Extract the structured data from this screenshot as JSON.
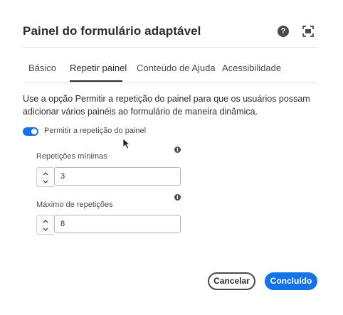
{
  "dialog": {
    "title": "Painel do formulário adaptável",
    "help_icon": "help-icon",
    "fullscreen_icon": "fullscreen-icon"
  },
  "tabs": [
    {
      "label": "Básico",
      "selected": false
    },
    {
      "label": "Repetir painel",
      "selected": true
    },
    {
      "label": "Conteúdo de Ajuda",
      "selected": false
    },
    {
      "label": "Acessibilidade",
      "selected": false
    }
  ],
  "panel": {
    "description": "Use a opção Permitir a repetição do painel para que os usuários possam adicionar vários painéis ao formulário de maneira dinâmica.",
    "toggle": {
      "label": "Permitir a repetição do painel",
      "checked": true
    },
    "min_repetitions": {
      "label": "Repetições mínimas",
      "value": "3"
    },
    "max_repetitions": {
      "label": "Máximo de repetições",
      "value": "8"
    }
  },
  "footer": {
    "cancel_label": "Cancelar",
    "done_label": "Concluído"
  },
  "colors": {
    "accent": "#1473e6",
    "text": "#2c2c2c",
    "icon": "#4b4b4b"
  }
}
